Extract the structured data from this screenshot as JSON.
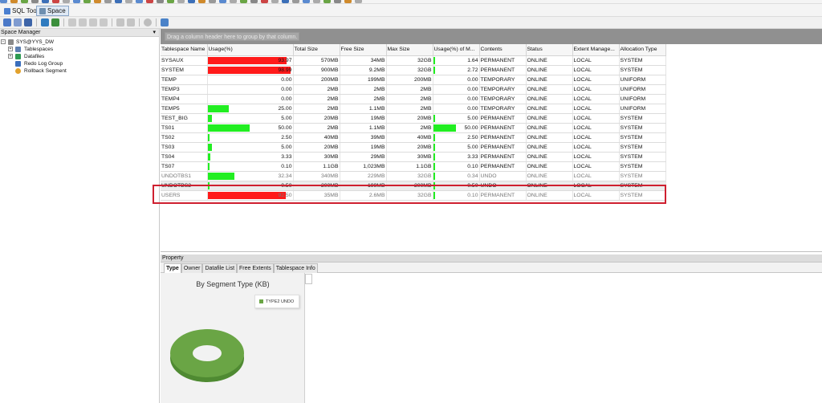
{
  "colors": {
    "red_bar": "#ff1a1a",
    "green_bar": "#22ee22",
    "highlight": "#cf2030",
    "donut": "#6aa545"
  },
  "tabs": [
    {
      "label": "SQL Tool",
      "icon": "sql-tool-icon"
    },
    {
      "label": "Space",
      "icon": "space-icon"
    }
  ],
  "left_panel": {
    "title": "Space Manager",
    "tree": [
      {
        "label": "SYS@YYS_DW",
        "icon": "database-icon"
      },
      {
        "label": "Tablespaces",
        "icon": "tablespace-icon"
      },
      {
        "label": "Datafiles",
        "icon": "datafile-icon"
      },
      {
        "label": "Redo Log Group",
        "icon": "redo-log-icon"
      },
      {
        "label": "Rollback Segment",
        "icon": "rollback-icon"
      }
    ]
  },
  "grid": {
    "group_hint": "Drag a column header here to group by that column.",
    "columns": [
      "Tablespace Name",
      "Usage(%)",
      "Total Size",
      "Free Size",
      "Max Size",
      "Usage(%) of M...",
      "Contents",
      "Status",
      "Extent Manage...",
      "Allocation Type"
    ],
    "rows": [
      {
        "name": "SYSAUX",
        "usage": "93.97",
        "usage_pct": 93.97,
        "total": "570MB",
        "free": "34MB",
        "max": "32GB",
        "usage_max": "1.64",
        "usage_max_pct": 1.64,
        "contents": "PERMANENT",
        "status": "ONLINE",
        "extent": "LOCAL",
        "alloc": "SYSTEM"
      },
      {
        "name": "SYSTEM",
        "usage": "98.99",
        "usage_pct": 98.99,
        "total": "900MB",
        "free": "9.2MB",
        "max": "32GB",
        "usage_max": "2.72",
        "usage_max_pct": 2.72,
        "contents": "PERMANENT",
        "status": "ONLINE",
        "extent": "LOCAL",
        "alloc": "SYSTEM"
      },
      {
        "name": "TEMP",
        "usage": "0.00",
        "usage_pct": 0,
        "total": "200MB",
        "free": "199MB",
        "max": "200MB",
        "usage_max": "0.00",
        "usage_max_pct": 0,
        "contents": "TEMPORARY",
        "status": "ONLINE",
        "extent": "LOCAL",
        "alloc": "UNIFORM"
      },
      {
        "name": "TEMP3",
        "usage": "0.00",
        "usage_pct": 0,
        "total": "2MB",
        "free": "2MB",
        "max": "2MB",
        "usage_max": "0.00",
        "usage_max_pct": 0,
        "contents": "TEMPORARY",
        "status": "ONLINE",
        "extent": "LOCAL",
        "alloc": "UNIFORM"
      },
      {
        "name": "TEMP4",
        "usage": "0.00",
        "usage_pct": 0,
        "total": "2MB",
        "free": "2MB",
        "max": "2MB",
        "usage_max": "0.00",
        "usage_max_pct": 0,
        "contents": "TEMPORARY",
        "status": "ONLINE",
        "extent": "LOCAL",
        "alloc": "UNIFORM"
      },
      {
        "name": "TEMP5",
        "usage": "25.00",
        "usage_pct": 25,
        "total": "2MB",
        "free": "1.1MB",
        "max": "2MB",
        "usage_max": "0.00",
        "usage_max_pct": 0,
        "contents": "TEMPORARY",
        "status": "ONLINE",
        "extent": "LOCAL",
        "alloc": "UNIFORM"
      },
      {
        "name": "TEST_BIG",
        "usage": "5.00",
        "usage_pct": 5,
        "total": "20MB",
        "free": "19MB",
        "max": "20MB",
        "usage_max": "5.00",
        "usage_max_pct": 5,
        "contents": "PERMANENT",
        "status": "ONLINE",
        "extent": "LOCAL",
        "alloc": "SYSTEM"
      },
      {
        "name": "TS01",
        "usage": "50.00",
        "usage_pct": 50,
        "total": "2MB",
        "free": "1.1MB",
        "max": "2MB",
        "usage_max": "50.00",
        "usage_max_pct": 50,
        "contents": "PERMANENT",
        "status": "ONLINE",
        "extent": "LOCAL",
        "alloc": "SYSTEM"
      },
      {
        "name": "TS02",
        "usage": "2.50",
        "usage_pct": 2.5,
        "total": "40MB",
        "free": "39MB",
        "max": "40MB",
        "usage_max": "2.50",
        "usage_max_pct": 2.5,
        "contents": "PERMANENT",
        "status": "ONLINE",
        "extent": "LOCAL",
        "alloc": "SYSTEM"
      },
      {
        "name": "TS03",
        "usage": "5.00",
        "usage_pct": 5,
        "total": "20MB",
        "free": "19MB",
        "max": "20MB",
        "usage_max": "5.00",
        "usage_max_pct": 5,
        "contents": "PERMANENT",
        "status": "ONLINE",
        "extent": "LOCAL",
        "alloc": "SYSTEM"
      },
      {
        "name": "TS04",
        "usage": "3.33",
        "usage_pct": 3.33,
        "total": "30MB",
        "free": "29MB",
        "max": "30MB",
        "usage_max": "3.33",
        "usage_max_pct": 3.33,
        "contents": "PERMANENT",
        "status": "ONLINE",
        "extent": "LOCAL",
        "alloc": "SYSTEM"
      },
      {
        "name": "TS07",
        "usage": "0.10",
        "usage_pct": 0.1,
        "total": "1.1GB",
        "free": "1,023MB",
        "max": "1.1GB",
        "usage_max": "0.10",
        "usage_max_pct": 0.1,
        "contents": "PERMANENT",
        "status": "ONLINE",
        "extent": "LOCAL",
        "alloc": "SYSTEM"
      },
      {
        "name": "UNDOTBS1",
        "usage": "32.34",
        "usage_pct": 32.34,
        "total": "340MB",
        "free": "229MB",
        "max": "32GB",
        "usage_max": "0.34",
        "usage_max_pct": 0.34,
        "contents": "UNDO",
        "status": "ONLINE",
        "extent": "LOCAL",
        "alloc": "SYSTEM"
      },
      {
        "name": "UNDOTBS2",
        "usage": "0.50",
        "usage_pct": 0.5,
        "total": "200MB",
        "free": "199MB",
        "max": "200MB",
        "usage_max": "0.50",
        "usage_max_pct": 0.5,
        "contents": "UNDO",
        "status": "ONLINE",
        "extent": "LOCAL",
        "alloc": "SYSTEM"
      },
      {
        "name": "USERS",
        "usage": "92.50",
        "usage_pct": 92.5,
        "total": "35MB",
        "free": "2.6MB",
        "max": "32GB",
        "usage_max": "0.10",
        "usage_max_pct": 0.1,
        "contents": "PERMANENT",
        "status": "ONLINE",
        "extent": "LOCAL",
        "alloc": "SYSTEM"
      }
    ],
    "selected_row": "UNDOTBS2"
  },
  "property": {
    "title": "Property",
    "tabs": [
      "Type",
      "Owner",
      "Datafile List",
      "Free Extents",
      "Tablespace Info"
    ],
    "active_tab": "Type"
  },
  "chart_data": {
    "type": "pie",
    "title": "By Segment Type (KB)",
    "categories": [
      "TYPE2 UNDO"
    ],
    "values": [
      100
    ],
    "legend": "top-right"
  }
}
